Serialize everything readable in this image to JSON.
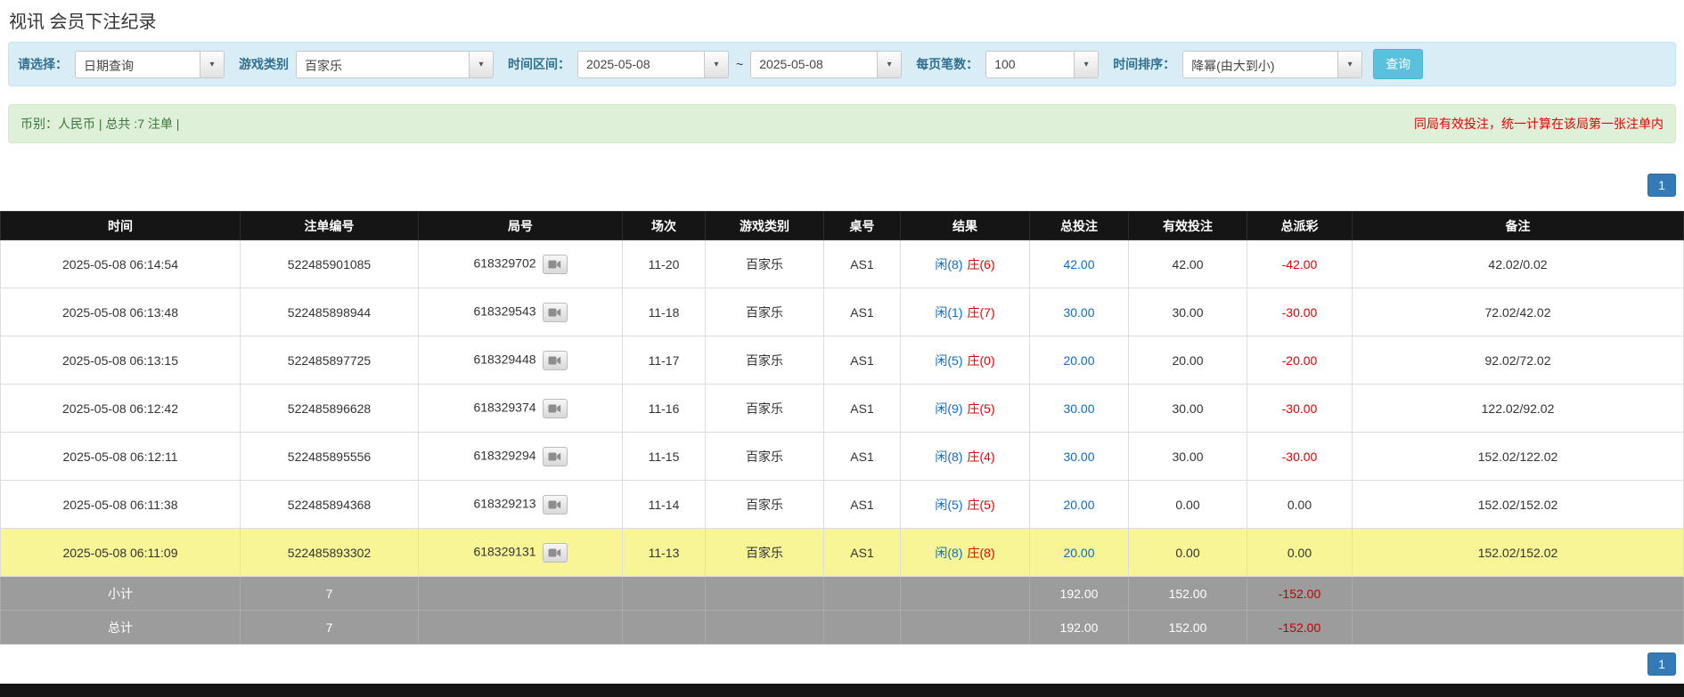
{
  "page": {
    "title": "视讯 会员下注纪录"
  },
  "icons": {
    "chevron_down": "▾"
  },
  "filters": {
    "select_label": "请选择：",
    "select_value": "日期查询",
    "game_type_label": "游戏类别",
    "game_type_value": "百家乐",
    "time_range_label": "时间区间：",
    "date_from": "2025-05-08",
    "range_separator": "~",
    "date_to": "2025-05-08",
    "page_size_label": "每页笔数：",
    "page_size_value": "100",
    "sort_label": "时间排序：",
    "sort_value": "降幂(由大到小)",
    "search_button": "查询"
  },
  "summary": {
    "currency_info": "币别：人民币 | 总共 :7 注单 |",
    "note": "同局有效投注，统一计算在该局第一张注单内"
  },
  "pagination": {
    "page": "1"
  },
  "colors": {
    "accent_blue": "#337ab7",
    "link_blue": "#0b6cce",
    "negative_red": "#e60000",
    "highlight_yellow": "#f7f596",
    "header_black": "#151515",
    "footer_gray": "#9c9c9c"
  },
  "table": {
    "headers": [
      "时间",
      "注单编号",
      "局号",
      "场次",
      "游戏类别",
      "桌号",
      "结果",
      "总投注",
      "有效投注",
      "总派彩",
      "备注"
    ],
    "rows": [
      {
        "time": "2025-05-08 06:14:54",
        "bet_id": "522485901085",
        "round_id": "618329702",
        "session": "11-20",
        "game": "百家乐",
        "table_no": "AS1",
        "result_player": "闲(8)",
        "result_banker": "庄(6)",
        "total_bet": "42.00",
        "valid_bet": "42.00",
        "payout": "-42.00",
        "remark": "42.02/0.02",
        "highlight": false
      },
      {
        "time": "2025-05-08 06:13:48",
        "bet_id": "522485898944",
        "round_id": "618329543",
        "session": "11-18",
        "game": "百家乐",
        "table_no": "AS1",
        "result_player": "闲(1)",
        "result_banker": "庄(7)",
        "total_bet": "30.00",
        "valid_bet": "30.00",
        "payout": "-30.00",
        "remark": "72.02/42.02",
        "highlight": false
      },
      {
        "time": "2025-05-08 06:13:15",
        "bet_id": "522485897725",
        "round_id": "618329448",
        "session": "11-17",
        "game": "百家乐",
        "table_no": "AS1",
        "result_player": "闲(5)",
        "result_banker": "庄(0)",
        "total_bet": "20.00",
        "valid_bet": "20.00",
        "payout": "-20.00",
        "remark": "92.02/72.02",
        "highlight": false
      },
      {
        "time": "2025-05-08 06:12:42",
        "bet_id": "522485896628",
        "round_id": "618329374",
        "session": "11-16",
        "game": "百家乐",
        "table_no": "AS1",
        "result_player": "闲(9)",
        "result_banker": "庄(5)",
        "total_bet": "30.00",
        "valid_bet": "30.00",
        "payout": "-30.00",
        "remark": "122.02/92.02",
        "highlight": false
      },
      {
        "time": "2025-05-08 06:12:11",
        "bet_id": "522485895556",
        "round_id": "618329294",
        "session": "11-15",
        "game": "百家乐",
        "table_no": "AS1",
        "result_player": "闲(8)",
        "result_banker": "庄(4)",
        "total_bet": "30.00",
        "valid_bet": "30.00",
        "payout": "-30.00",
        "remark": "152.02/122.02",
        "highlight": false
      },
      {
        "time": "2025-05-08 06:11:38",
        "bet_id": "522485894368",
        "round_id": "618329213",
        "session": "11-14",
        "game": "百家乐",
        "table_no": "AS1",
        "result_player": "闲(5)",
        "result_banker": "庄(5)",
        "total_bet": "20.00",
        "valid_bet": "0.00",
        "payout": "0.00",
        "remark": "152.02/152.02",
        "highlight": false
      },
      {
        "time": "2025-05-08 06:11:09",
        "bet_id": "522485893302",
        "round_id": "618329131",
        "session": "11-13",
        "game": "百家乐",
        "table_no": "AS1",
        "result_player": "闲(8)",
        "result_banker": "庄(8)",
        "total_bet": "20.00",
        "valid_bet": "0.00",
        "payout": "0.00",
        "remark": "152.02/152.02",
        "highlight": true
      }
    ],
    "subtotal": {
      "label": "小计",
      "count": "7",
      "total_bet": "192.00",
      "valid_bet": "152.00",
      "payout": "-152.00"
    },
    "total": {
      "label": "总计",
      "count": "7",
      "total_bet": "192.00",
      "valid_bet": "152.00",
      "payout": "-152.00"
    }
  }
}
